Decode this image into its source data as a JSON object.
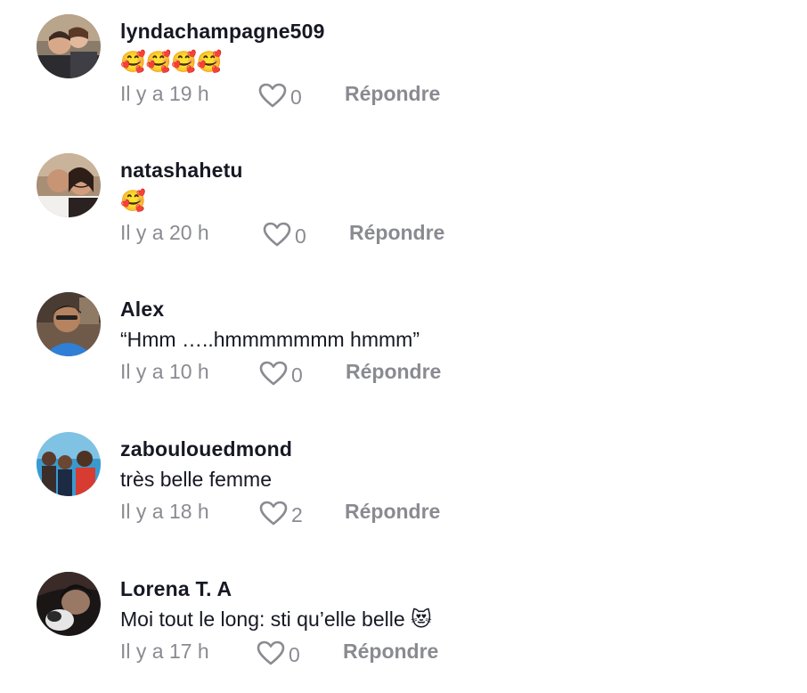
{
  "comments": [
    {
      "username": "lyndachampagne509",
      "text": "🥰🥰🥰🥰",
      "time": "Il y a 19 h",
      "likes": "0",
      "reply_label": "Répondre"
    },
    {
      "username": "natashahetu",
      "text": "🥰",
      "time": "Il y a 20 h",
      "likes": "0",
      "reply_label": "Répondre"
    },
    {
      "username": "Alex",
      "text": "“Hmm …..hmmmmmmm hmmm”",
      "time": "Il y a 10 h",
      "likes": "0",
      "reply_label": "Répondre"
    },
    {
      "username": "zaboulouedmond",
      "text": "très belle femme",
      "time": "Il y a 18 h",
      "likes": "2",
      "reply_label": "Répondre"
    },
    {
      "username": "Lorena T. A",
      "text": "Moi tout le long: sti qu’elle belle 😻",
      "time": "Il y a 17 h",
      "likes": "0",
      "reply_label": "Répondre"
    }
  ],
  "icons": {
    "like": "heart-outline-icon"
  },
  "colors": {
    "username": "#161823",
    "meta": "#8a8b91",
    "background": "#ffffff"
  }
}
